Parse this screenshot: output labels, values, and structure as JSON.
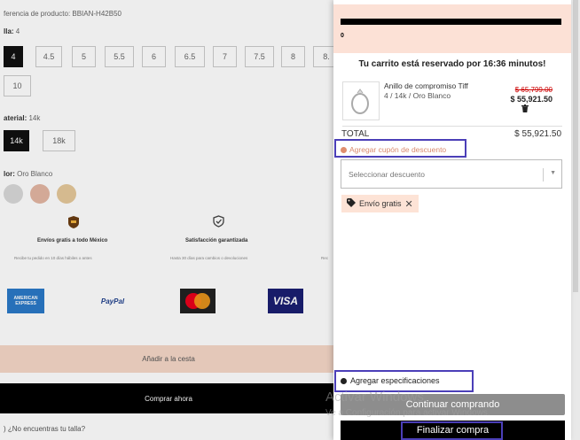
{
  "product": {
    "reference": "ferencia de producto: BBIAN-H42B50",
    "size_label": "lla:",
    "size_value": "4",
    "sizes": [
      "4",
      "4.5",
      "5",
      "5.5",
      "6",
      "6.5",
      "7",
      "7.5",
      "8",
      "8.",
      "10"
    ],
    "material_label": "aterial:",
    "material_value": "14k",
    "materials": [
      "14k",
      "18k"
    ],
    "color_label": "lor:",
    "color_value": "Oro Blanco",
    "swatch_colors": [
      "#d9d9d9",
      "#e3b6a3",
      "#e6c99a"
    ],
    "features": [
      {
        "icon": "ups-truck-icon",
        "title": "Envíos gratis a todo México",
        "subtitle": "Recibe tu pedido en 10 días hábiles o antes"
      },
      {
        "icon": "shield-check-icon",
        "title": "Satisfacción garantizada",
        "subtitle": "Hasta 30 días para cambios o devoluciones"
      },
      {
        "icon": "",
        "title": "",
        "subtitle": "Rec"
      }
    ],
    "payments": [
      "AMERICAN EXPRESS",
      "PayPal",
      "MasterCard",
      "VISA"
    ],
    "add_to_cart": "Añadir a la cesta",
    "buy_now": "Comprar ahora",
    "no_size": ") ¿No encuentras tu talla?"
  },
  "cart": {
    "header_zero": "0",
    "reserved_message": "Tu carrito está reservado por 16:36 minutos!",
    "item": {
      "name": "Anillo de compromiso Tiff",
      "variant": "4 / 14k / Oro Blanco",
      "old_price": "$ 65,799.00",
      "price": "$ 55,921.50"
    },
    "total_label": "TOTAL",
    "total_value": "$ 55,921.50",
    "coupon_link": "Agregar cupón de descuento",
    "discount_placeholder": "Seleccionar descuento",
    "discount_tag": "Envío gratis",
    "specs_link": "Agregar especificaciones",
    "continue_label": "Continuar comprando",
    "checkout_label": "Finalizar compra"
  },
  "watermark": {
    "line1": "Activar Windows",
    "line2": "Ve a Configuración para activar Windows."
  },
  "colors": {
    "accent_highlight": "#4b3fb8",
    "drawer_header_bg": "#fce1d6",
    "coupon_link": "#d98a6f",
    "strike_price": "#cc0000"
  }
}
